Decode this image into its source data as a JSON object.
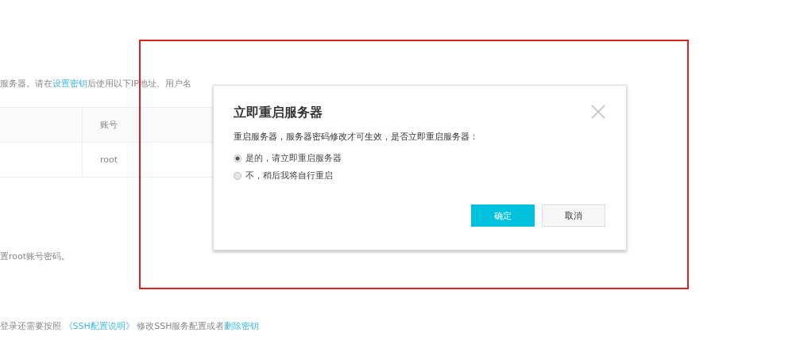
{
  "page": {
    "intro": {
      "before": "服务器。请在",
      "link": "设置密钥",
      "after": "后使用以下IP地址、用户名"
    },
    "table": {
      "columns": [
        "",
        "账号"
      ],
      "rows": [
        [
          "",
          "root"
        ]
      ]
    },
    "password_note": "置root账号密码。",
    "ssh_note": {
      "before": "登录还需要按照 ",
      "link1": "《SSH配置说明》",
      "middle": " 修改SSH服务配置或者",
      "link2": "删除密钥"
    }
  },
  "dialog": {
    "title": "立即重启服务器",
    "message": "重启服务器，服务器密码修改才可生效，是否立即重启服务器：",
    "options": [
      {
        "label": "是的，请立即重启服务器",
        "selected": true
      },
      {
        "label": "不，稍后我将自行重启",
        "selected": false
      }
    ],
    "buttons": [
      {
        "label": "确定",
        "kind": "primary"
      },
      {
        "label": "取消",
        "kind": "secondary"
      }
    ]
  },
  "annotation": {
    "kind": "frame"
  }
}
